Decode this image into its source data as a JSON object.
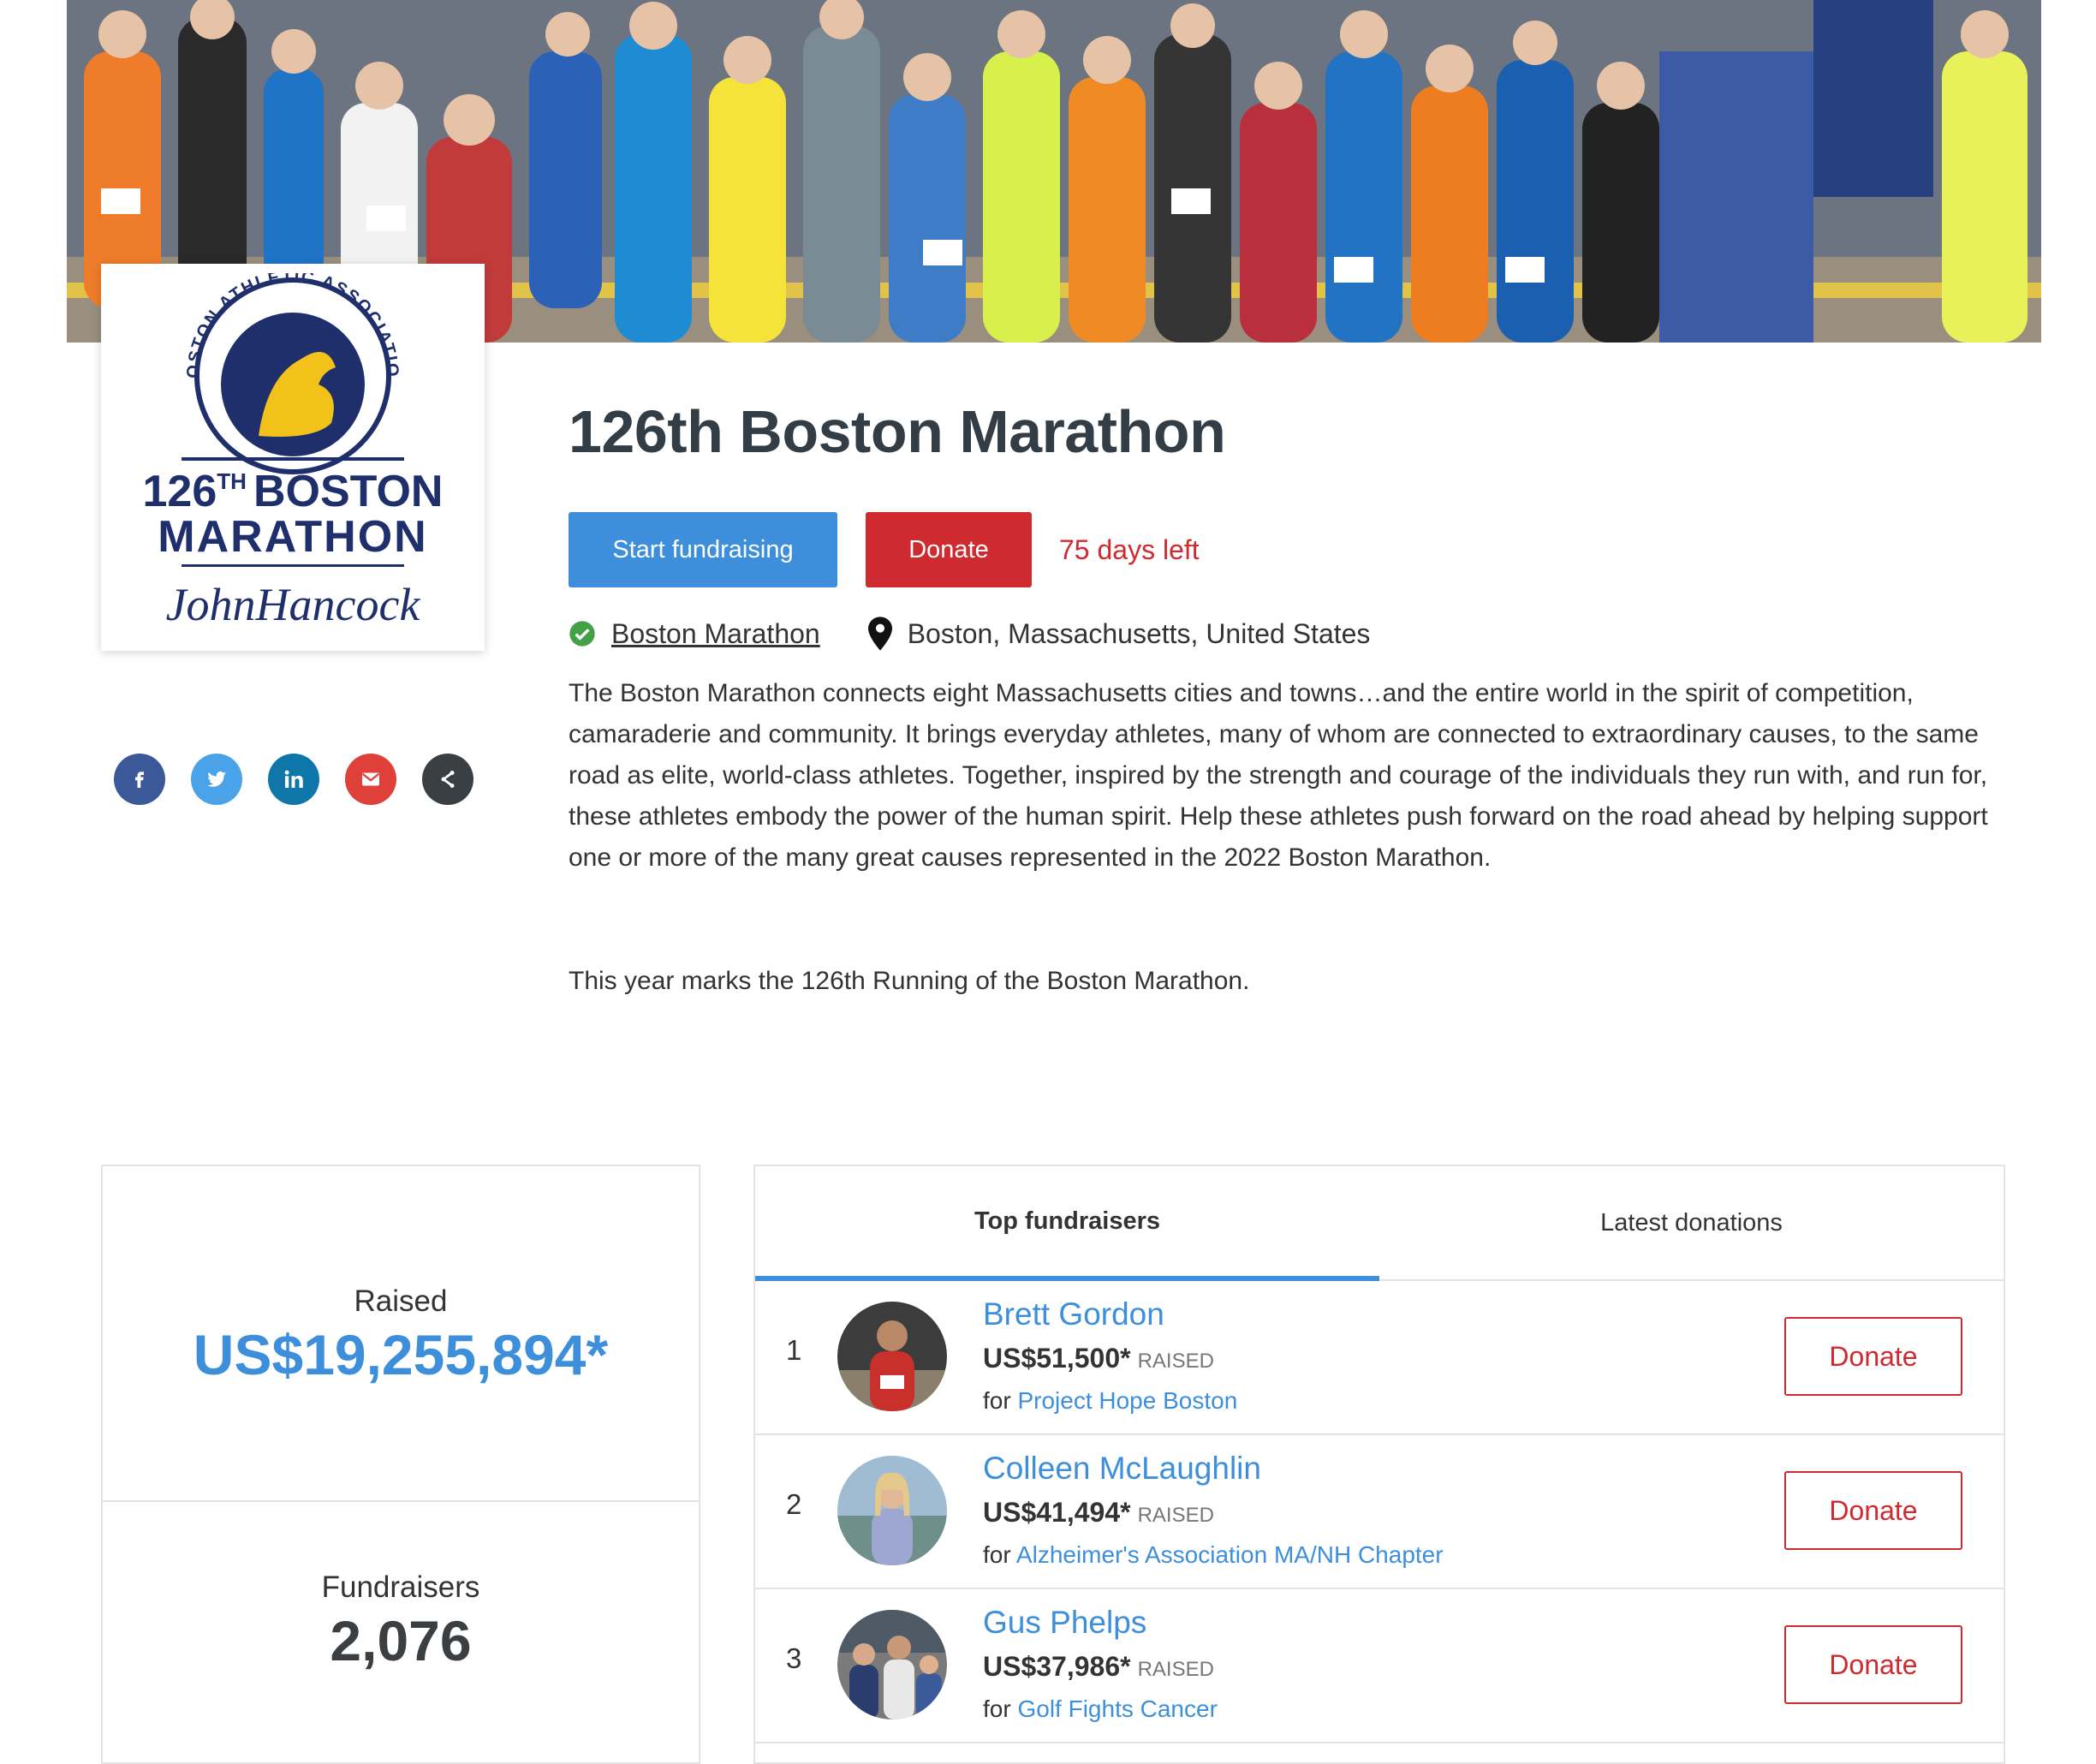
{
  "hero": {
    "alt": "Boston Marathon runners"
  },
  "logo": {
    "ring_text": "BOSTON ATHLETIC ASSOCIATION",
    "line1_num": "126",
    "line1_sup": "TH",
    "line1_word": "BOSTON",
    "line2": "MARATHON",
    "sponsor": "JohnHancock"
  },
  "share": {
    "icons": [
      "facebook-icon",
      "twitter-icon",
      "linkedin-icon",
      "email-icon",
      "share-icon"
    ]
  },
  "event": {
    "title": "126th Boston Marathon",
    "start_label": "Start fundraising",
    "donate_label": "Donate",
    "days_left": "75 days left",
    "organizer": "Boston Marathon",
    "location": "Boston, Massachusetts, United States",
    "description": "The Boston Marathon connects eight Massachusetts cities and towns…and the entire world in the spirit of competition, camaraderie and community. It brings everyday athletes, many of whom are connected to extraordinary causes, to the same road as elite, world-class athletes. Together, inspired by the strength and courage of the individuals they run with, and run for, these athletes embody the power of the human spirit. Help these athletes push forward on the road ahead by helping support one or more of the many great causes represented in the 2022 Boston Marathon.",
    "description2": "This year marks the 126th Running of the Boston Marathon."
  },
  "stats": {
    "raised_label": "Raised",
    "raised_value": "US$19,255,894*",
    "fundraisers_label": "Fundraisers",
    "fundraisers_value": "2,076"
  },
  "tabs": [
    {
      "label": "Top fundraisers",
      "active": true
    },
    {
      "label": "Latest donations",
      "active": false
    }
  ],
  "fundraisers": [
    {
      "rank": "1",
      "name": "Brett Gordon",
      "amount": "US$51,500*",
      "raised": "RAISED",
      "for": "for",
      "charity": "Project Hope Boston",
      "donate": "Donate"
    },
    {
      "rank": "2",
      "name": "Colleen McLaughlin",
      "amount": "US$41,494*",
      "raised": "RAISED",
      "for": "for",
      "charity": "Alzheimer's Association MA/NH Chapter",
      "donate": "Donate"
    },
    {
      "rank": "3",
      "name": "Gus Phelps",
      "amount": "US$37,986*",
      "raised": "RAISED",
      "for": "for",
      "charity": "Golf Fights Cancer",
      "donate": "Donate"
    }
  ],
  "colors": {
    "primary": "#3d8fdb",
    "danger": "#cf2a2f",
    "verified": "#43a047",
    "logo_navy": "#1f2f6b",
    "logo_gold": "#f2c21b"
  }
}
